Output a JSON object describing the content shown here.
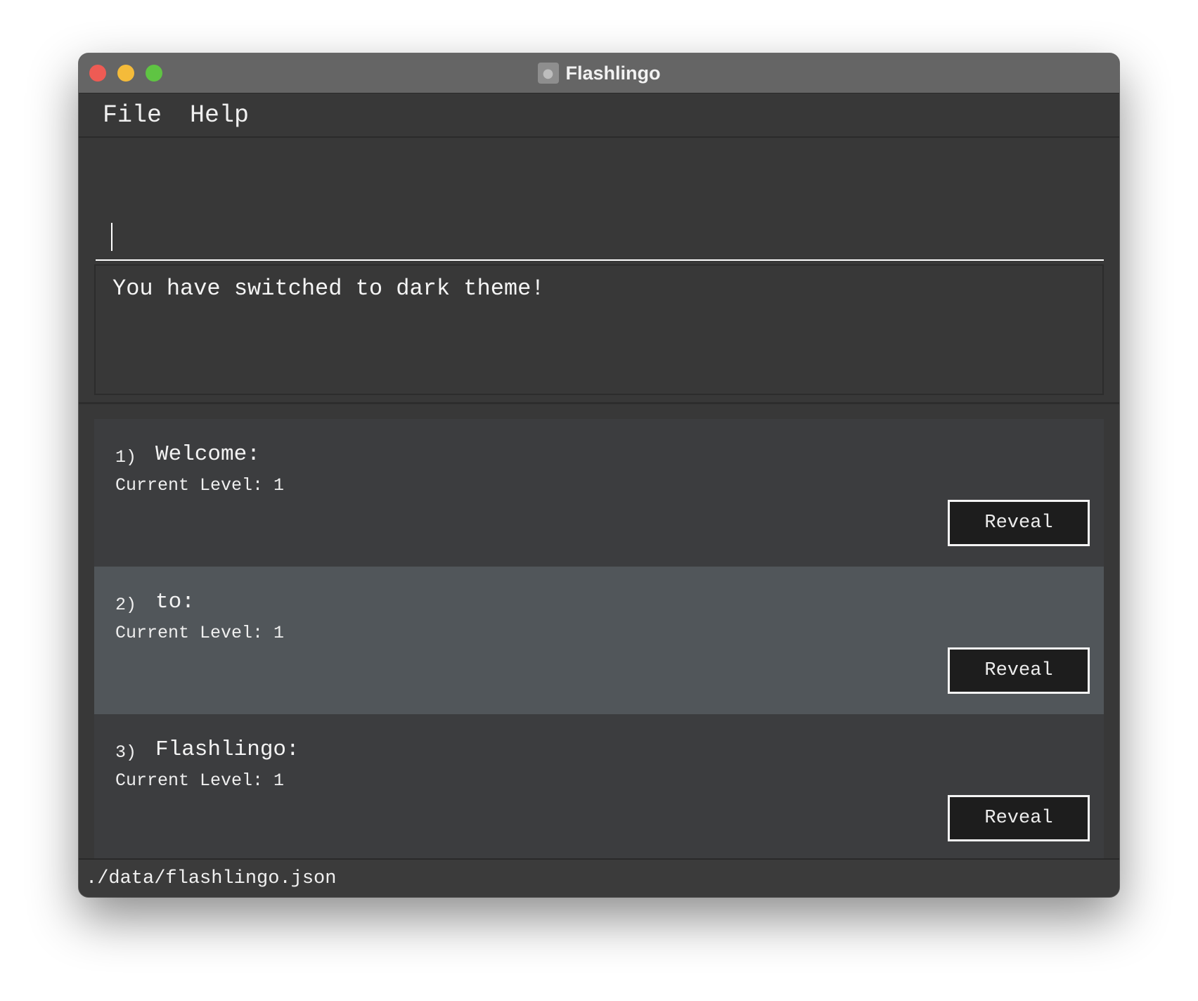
{
  "window": {
    "title": "Flashlingo"
  },
  "menu": {
    "items": [
      "File",
      "Help"
    ]
  },
  "command": {
    "value": "",
    "placeholder": ""
  },
  "result": {
    "message": "You have switched to dark theme!"
  },
  "cards": [
    {
      "index": "1)",
      "word": "Welcome:",
      "level": "Current Level: 1",
      "button": "Reveal"
    },
    {
      "index": "2)",
      "word": "to:",
      "level": "Current Level: 1",
      "button": "Reveal"
    },
    {
      "index": "3)",
      "word": "Flashlingo:",
      "level": "Current Level: 1",
      "button": "Reveal"
    }
  ],
  "status": {
    "path": "./data/flashlingo.json"
  },
  "colors": {
    "background": "#383838",
    "titlebar": "#656565",
    "card": "#3c3d3f",
    "card_selected": "#51565a",
    "button_bg": "#1d1d1d",
    "close": "#ee5b54",
    "minimize": "#f4bb3a",
    "maximize": "#5fc443"
  }
}
